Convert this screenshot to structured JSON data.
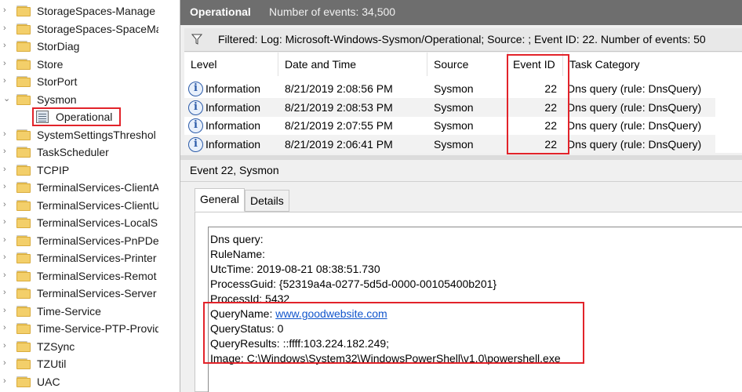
{
  "tree": {
    "items": [
      {
        "label": "StorageSpaces-Manage",
        "expand": "›"
      },
      {
        "label": "StorageSpaces-SpaceMa",
        "expand": "›"
      },
      {
        "label": "StorDiag",
        "expand": "›"
      },
      {
        "label": "Store",
        "expand": "›"
      },
      {
        "label": "StorPort",
        "expand": "›"
      },
      {
        "label": "Sysmon",
        "expand": "⌄"
      },
      {
        "label": "Operational",
        "expand": ""
      },
      {
        "label": "SystemSettingsThreshol",
        "expand": "›"
      },
      {
        "label": "TaskScheduler",
        "expand": "›"
      },
      {
        "label": "TCPIP",
        "expand": "›"
      },
      {
        "label": "TerminalServices-ClientA",
        "expand": "›"
      },
      {
        "label": "TerminalServices-ClientU",
        "expand": "›"
      },
      {
        "label": "TerminalServices-LocalS",
        "expand": "›"
      },
      {
        "label": "TerminalServices-PnPDe",
        "expand": "›"
      },
      {
        "label": "TerminalServices-Printer",
        "expand": "›"
      },
      {
        "label": "TerminalServices-Remot",
        "expand": "›"
      },
      {
        "label": "TerminalServices-Server",
        "expand": "›"
      },
      {
        "label": "Time-Service",
        "expand": "›"
      },
      {
        "label": "Time-Service-PTP-Provid",
        "expand": "›"
      },
      {
        "label": "TZSync",
        "expand": "›"
      },
      {
        "label": "TZUtil",
        "expand": "›"
      },
      {
        "label": "UAC",
        "expand": "›"
      }
    ]
  },
  "header": {
    "title": "Operational",
    "count": "Number of events: 34,500"
  },
  "filter": {
    "text": "Filtered: Log: Microsoft-Windows-Sysmon/Operational; Source: ; Event ID: 22. Number of events: 50"
  },
  "grid": {
    "columns": [
      "Level",
      "Date and Time",
      "Source",
      "Event ID",
      "Task Category"
    ],
    "rows": [
      {
        "level": "Information",
        "datetime": "8/21/2019 2:08:56 PM",
        "source": "Sysmon",
        "event_id": "22",
        "category": "Dns query (rule: DnsQuery)"
      },
      {
        "level": "Information",
        "datetime": "8/21/2019 2:08:53 PM",
        "source": "Sysmon",
        "event_id": "22",
        "category": "Dns query (rule: DnsQuery)"
      },
      {
        "level": "Information",
        "datetime": "8/21/2019 2:07:55 PM",
        "source": "Sysmon",
        "event_id": "22",
        "category": "Dns query (rule: DnsQuery)"
      },
      {
        "level": "Information",
        "datetime": "8/21/2019 2:06:41 PM",
        "source": "Sysmon",
        "event_id": "22",
        "category": "Dns query (rule: DnsQuery)"
      }
    ]
  },
  "detail": {
    "header": "Event 22, Sysmon",
    "tabs": [
      "General",
      "Details"
    ],
    "lines": {
      "l1": "Dns query:",
      "l2": "RuleName:",
      "l3": "UtcTime: 2019-08-21 08:38:51.730",
      "l4": "ProcessGuid: {52319a4a-0277-5d5d-0000-00105400b201}",
      "l5": "ProcessId: 5432",
      "l6_key": "QueryName: ",
      "l6_link": "www.goodwebsite.com",
      "l7": "QueryStatus: 0",
      "l8": "QueryResults: ::ffff:103.224.182.249;",
      "l9": "Image: C:\\Windows\\System32\\WindowsPowerShell\\v1.0\\powershell.exe"
    }
  },
  "colors": {
    "highlight": "#e2232a",
    "titlebar": "#6e6e6e",
    "link": "#1155cc"
  }
}
